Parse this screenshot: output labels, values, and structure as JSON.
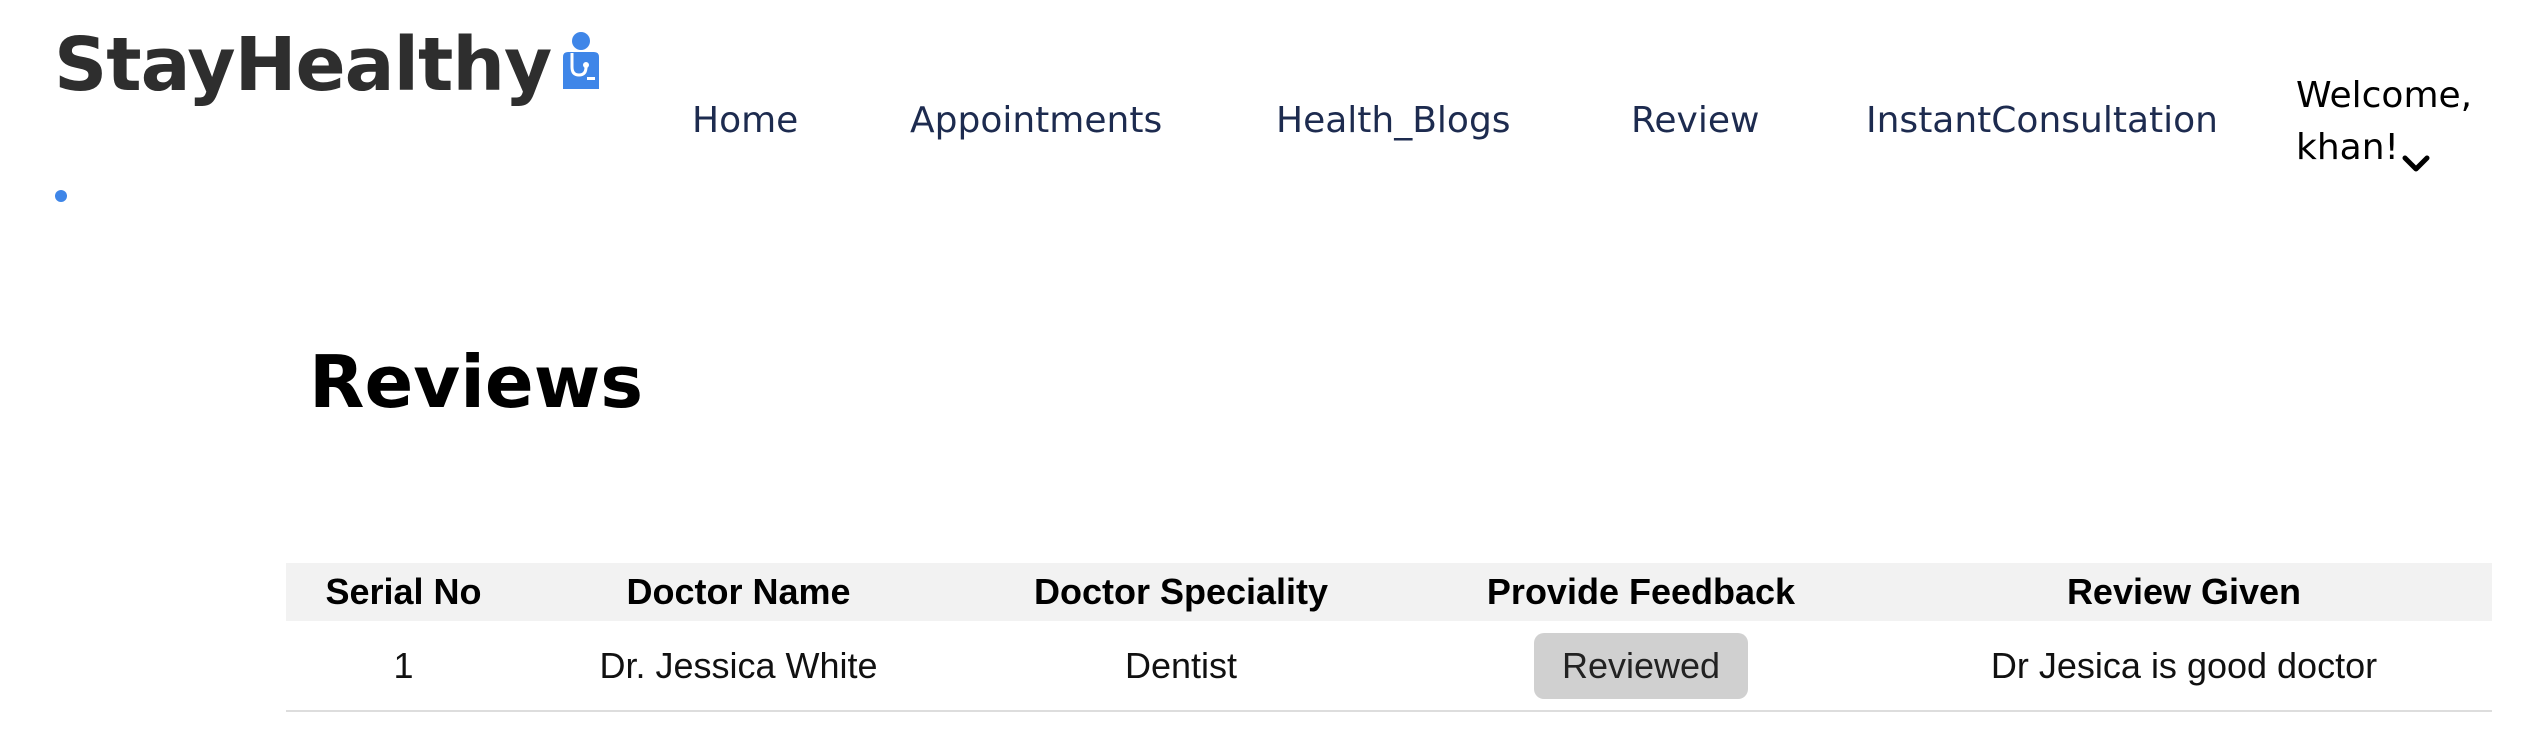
{
  "brand": {
    "name": "StayHealthy",
    "icon": "doctor-icon",
    "accent_color": "#3f86e8"
  },
  "nav": {
    "items": [
      {
        "label": "Home"
      },
      {
        "label": "Appointments"
      },
      {
        "label": "Health_Blogs"
      },
      {
        "label": "Review"
      },
      {
        "label": "InstantConsultation"
      }
    ],
    "welcome_line1": "Welcome,",
    "welcome_line2": "khan!",
    "dropdown_icon": "chevron-down-icon"
  },
  "page": {
    "title": "Reviews"
  },
  "table": {
    "headers": [
      "Serial No",
      "Doctor Name",
      "Doctor Speciality",
      "Provide Feedback",
      "Review Given"
    ],
    "rows": [
      {
        "serial": "1",
        "doctor_name": "Dr. Jessica White",
        "speciality": "Dentist",
        "feedback_button": "Reviewed",
        "review": "Dr Jesica is good doctor"
      }
    ]
  }
}
